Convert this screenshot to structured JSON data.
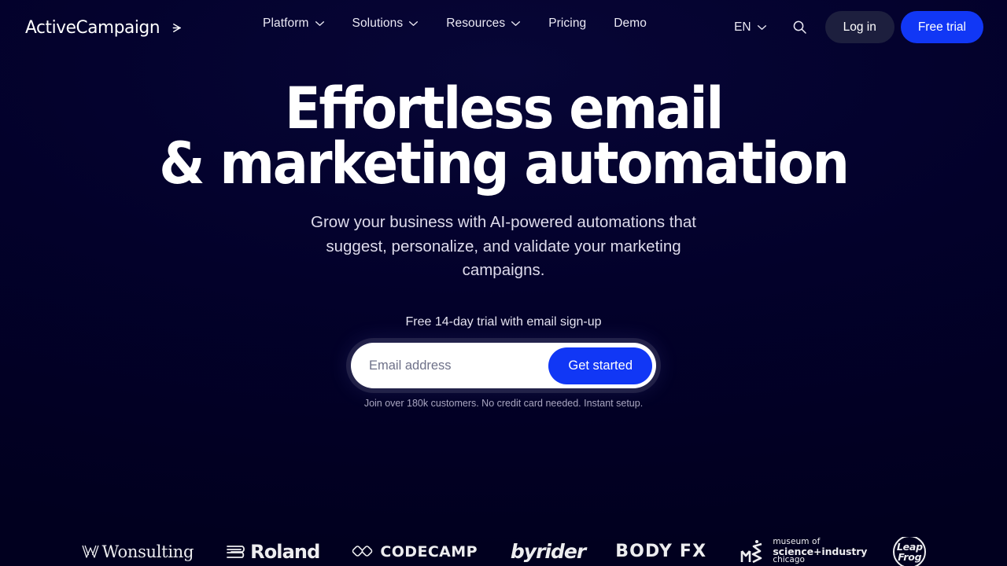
{
  "brand": {
    "name": "ActiveCampaign",
    "arrow_icon": "chevron-right-line-icon"
  },
  "nav": {
    "items": [
      {
        "label": "Platform",
        "has_dropdown": true
      },
      {
        "label": "Solutions",
        "has_dropdown": true
      },
      {
        "label": "Resources",
        "has_dropdown": true
      },
      {
        "label": "Pricing",
        "has_dropdown": false
      },
      {
        "label": "Demo",
        "has_dropdown": false
      }
    ]
  },
  "header_actions": {
    "language": "EN",
    "language_icon": "chevron-down-icon",
    "search_icon": "search-icon",
    "login_label": "Log in",
    "trial_label": "Free trial"
  },
  "hero": {
    "headline_line1": "Effortless email",
    "headline_line2": "& marketing automation",
    "subheading": "Grow your business with AI-powered automations that suggest, personalize, and validate your marketing campaigns.",
    "trial_note": "Free 14-day trial with email sign-up",
    "email_placeholder": "Email address",
    "email_value": "",
    "cta_label": "Get started",
    "fine_print": "Join over 180k customers. No credit card needed. Instant setup."
  },
  "logos": [
    {
      "name": "Wonsulting",
      "icon": "wonsulting-w-icon"
    },
    {
      "name": "Roland",
      "icon": "roland-ribbon-icon"
    },
    {
      "name": "CODECAMP",
      "icon": "codecamp-diamond-icon"
    },
    {
      "name": "byrider",
      "icon": "byrider-wordmark"
    },
    {
      "name": "BODY FX",
      "icon": "bodyfx-wordmark"
    },
    {
      "name": "museum of science+industry chicago",
      "icon": "msi-monogram-icon",
      "line1": "museum of",
      "line2": "science+industry",
      "line3": "chicago"
    },
    {
      "name": "Leap Frog",
      "icon": "leapfrog-badge-icon",
      "line1": "Leap",
      "line2": "Frog"
    }
  ],
  "colors": {
    "background": "#02002a",
    "accent_blue": "#1137f5",
    "login_pill": "#1d1f3e",
    "text_primary": "#ffffff",
    "text_muted": "#a9a6c0"
  }
}
